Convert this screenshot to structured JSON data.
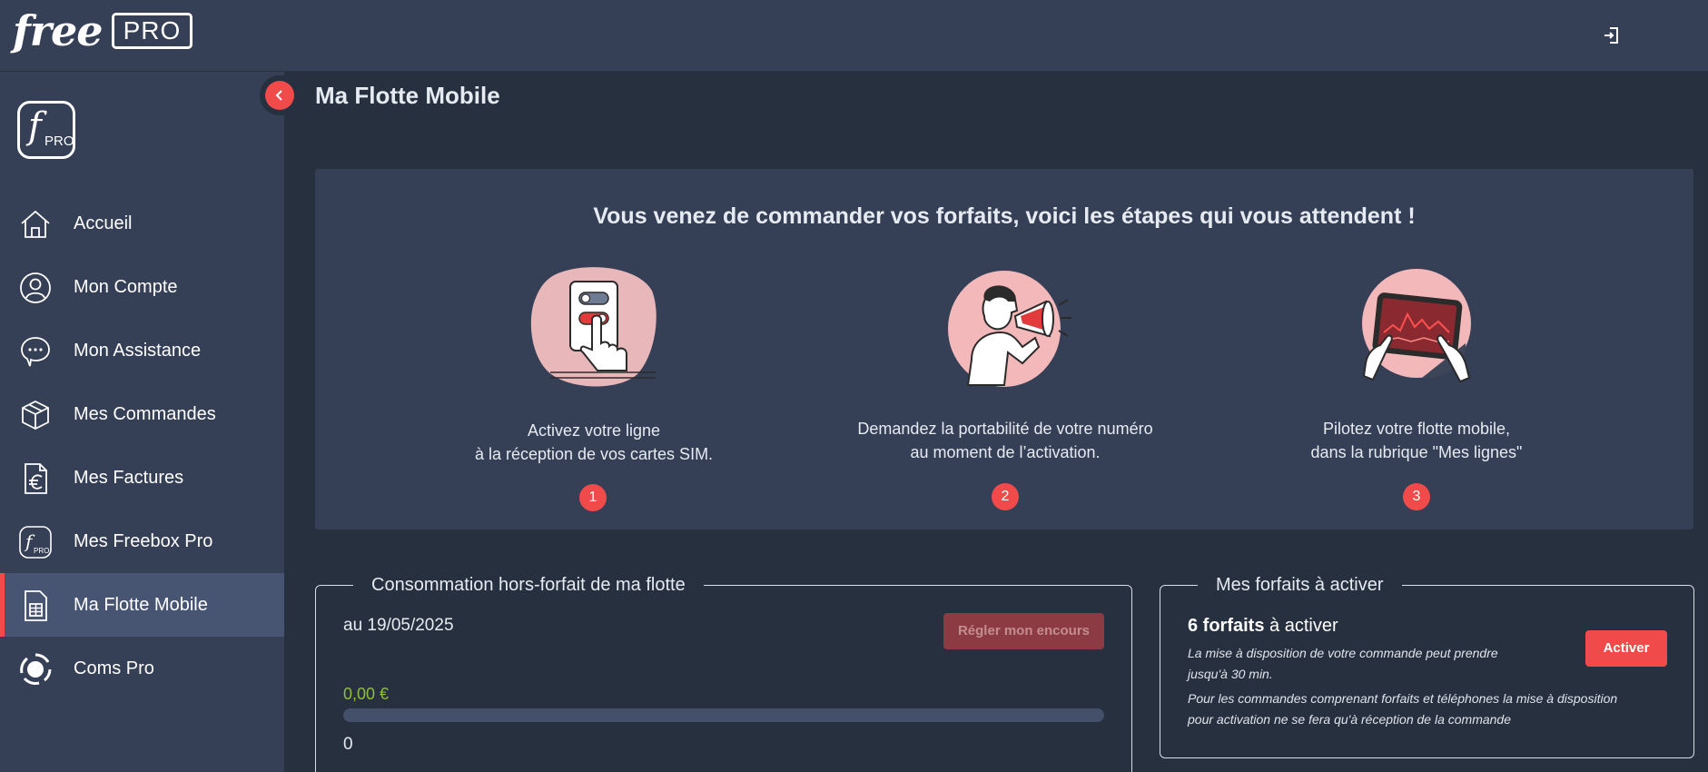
{
  "brand": {
    "name": "free",
    "badge": "PRO"
  },
  "sidebar": {
    "logo_letter": "f",
    "logo_badge": "PRO",
    "items": [
      {
        "label": "Accueil",
        "icon": "home-icon"
      },
      {
        "label": "Mon Compte",
        "icon": "user-icon"
      },
      {
        "label": "Mon Assistance",
        "icon": "chat-icon"
      },
      {
        "label": "Mes Commandes",
        "icon": "box-icon"
      },
      {
        "label": "Mes Factures",
        "icon": "invoice-euro-icon"
      },
      {
        "label": "Mes Freebox Pro",
        "icon": "freebox-pro-icon"
      },
      {
        "label": "Ma Flotte Mobile",
        "icon": "sim-card-icon",
        "active": true
      },
      {
        "label": "Coms Pro",
        "icon": "coms-pro-icon"
      }
    ]
  },
  "page": {
    "title": "Ma Flotte Mobile"
  },
  "steps": {
    "title": "Vous venez de commander vos forfaits, voici les étapes qui vous attendent !",
    "items": [
      {
        "line1": "Activez votre ligne",
        "line2": "à la réception de vos cartes SIM.",
        "num": "1"
      },
      {
        "line1": "Demandez la portabilité de votre numéro",
        "line2": "au moment de l’activation.",
        "num": "2"
      },
      {
        "line1": "Pilotez votre flotte mobile,",
        "line2": "dans la rubrique \"Mes lignes\"",
        "num": "3"
      }
    ]
  },
  "conso": {
    "legend": "Consommation hors-forfait de ma flotte",
    "date": "au 19/05/2025",
    "pay_button": "Régler mon encours",
    "amount": "0,00 €",
    "progress": 0,
    "min_label": "0"
  },
  "forfaits": {
    "legend": "Mes forfaits à activer",
    "count_bold": "6 forfaits",
    "count_rest": " à activer",
    "note1a": "La mise à disposition de votre commande peut prendre",
    "note1b": "jusqu'à 30 min.",
    "note2a": "Pour les commandes comprenant forfaits et téléphones la mise à disposition",
    "note2b": "pour activation ne se fera qu'à réception de la commande",
    "activate_button": "Activer"
  },
  "colors": {
    "accent": "#f04a4a",
    "sidebar_bg": "#353f55",
    "page_bg": "#27303f",
    "amount_green": "#8fbf3c"
  }
}
